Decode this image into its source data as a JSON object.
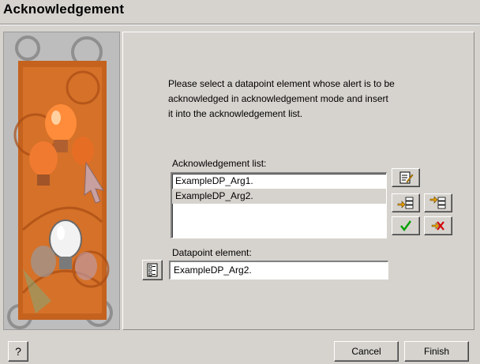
{
  "window": {
    "title": "Acknowledgement"
  },
  "description": "Please select a datapoint element whose alert is to be\nacknowledged in acknowledgement mode and insert\nit into the acknowledgement list.",
  "ack_list": {
    "label": "Acknowledgement list:",
    "items": [
      {
        "text": "ExampleDP_Arg1.",
        "selected": false
      },
      {
        "text": "ExampleDP_Arg2.",
        "selected": true
      }
    ]
  },
  "datapoint": {
    "label": "Datapoint element:",
    "value": "ExampleDP_Arg2."
  },
  "toolbar": {
    "icons": [
      "edit-icon",
      "insert-icon",
      "insert-after-icon",
      "checkmark-icon",
      "delete-icon",
      "datapoint-selector-icon"
    ],
    "colors": {
      "check": "#00a000",
      "delete": "#d00000",
      "accent": "#e8a000"
    }
  },
  "footer": {
    "help_label": "?",
    "cancel_label": "Cancel",
    "finish_label": "Finish"
  }
}
